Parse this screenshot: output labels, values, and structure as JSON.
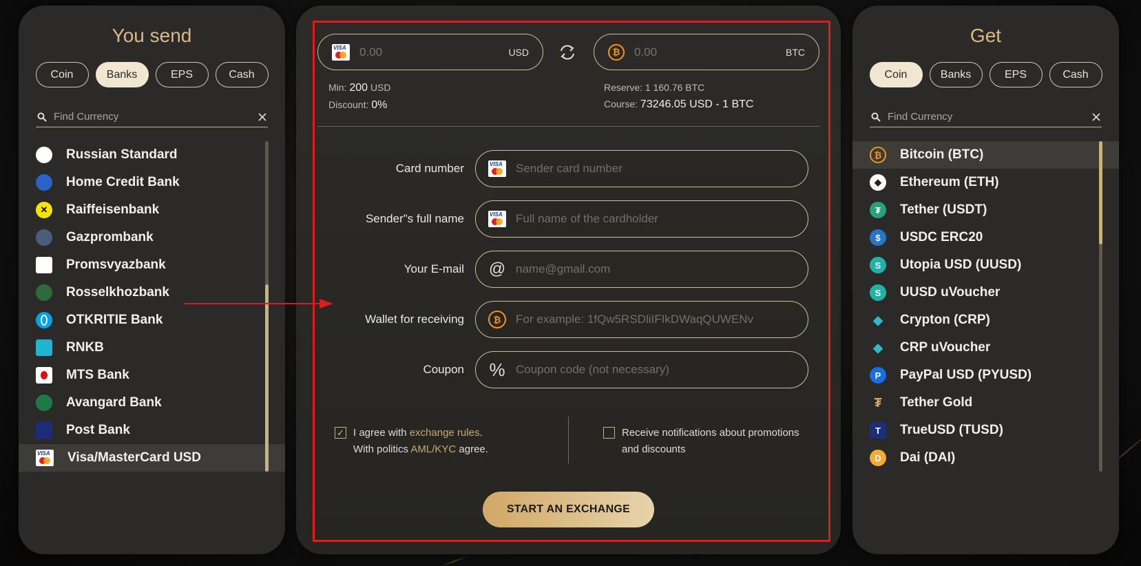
{
  "left": {
    "title": "You send",
    "filters": [
      {
        "label": "Coin",
        "active": false
      },
      {
        "label": "Banks",
        "active": true
      },
      {
        "label": "EPS",
        "active": false
      },
      {
        "label": "Cash",
        "active": false
      }
    ],
    "search_placeholder": "Find Currency",
    "items": [
      {
        "label": "Russian Standard",
        "icon": "russian-standard-icon",
        "color": "#ffffff",
        "selected": false
      },
      {
        "label": "Home Credit Bank",
        "icon": "home-credit-icon",
        "color": "#2a62c9",
        "selected": false
      },
      {
        "label": "Raiffeisenbank",
        "icon": "raiffeisen-icon",
        "color": "#f5e400",
        "selected": false
      },
      {
        "label": "Gazprombank",
        "icon": "gazprombank-icon",
        "color": "#4a5d7a",
        "selected": false
      },
      {
        "label": "Promsvyazbank",
        "icon": "promsvyazbank-icon",
        "color": "#ffffff",
        "selected": false
      },
      {
        "label": "Rosselkhozbank",
        "icon": "rosselkhozbank-icon",
        "color": "#2e6b3a",
        "selected": false
      },
      {
        "label": "OTKRITIE Bank",
        "icon": "otkritie-icon",
        "color": "#00a4e4",
        "selected": false
      },
      {
        "label": "RNKB",
        "icon": "rnkb-icon",
        "color": "#1fb5d0",
        "selected": false
      },
      {
        "label": "MTS Bank",
        "icon": "mts-bank-icon",
        "color": "#ffffff",
        "selected": false
      },
      {
        "label": "Avangard Bank",
        "icon": "avangard-icon",
        "color": "#1e7a45",
        "selected": false
      },
      {
        "label": "Post Bank",
        "icon": "post-bank-icon",
        "color": "#1c2c7a",
        "selected": false
      },
      {
        "label": "Visa/MasterCard USD",
        "icon": "visa-mastercard-icon",
        "color": "#ffffff",
        "selected": true
      }
    ]
  },
  "right": {
    "title": "Get",
    "filters": [
      {
        "label": "Coin",
        "active": true
      },
      {
        "label": "Banks",
        "active": false
      },
      {
        "label": "EPS",
        "active": false
      },
      {
        "label": "Cash",
        "active": false
      }
    ],
    "search_placeholder": "Find Currency",
    "items": [
      {
        "label": "Bitcoin (BTC)",
        "icon": "bitcoin-icon",
        "glyph": "₿",
        "color": "#f7931a",
        "selected": true
      },
      {
        "label": "Ethereum (ETH)",
        "icon": "ethereum-icon",
        "glyph": "◆",
        "color": "#ffffff",
        "selected": false
      },
      {
        "label": "Tether (USDT)",
        "icon": "tether-icon",
        "glyph": "₮",
        "color": "#26a17b",
        "selected": false
      },
      {
        "label": "USDC ERC20",
        "icon": "usdc-icon",
        "glyph": "$",
        "color": "#2775ca",
        "selected": false
      },
      {
        "label": "Utopia USD (UUSD)",
        "icon": "utopia-usd-icon",
        "glyph": "S",
        "color": "#1fb3a8",
        "selected": false
      },
      {
        "label": "UUSD uVoucher",
        "icon": "uusd-voucher-icon",
        "glyph": "S",
        "color": "#1fb3a8",
        "selected": false
      },
      {
        "label": "Crypton (CRP)",
        "icon": "crypton-icon",
        "glyph": "◆",
        "color": "#2fb9c9",
        "selected": false
      },
      {
        "label": "CRP uVoucher",
        "icon": "crp-voucher-icon",
        "glyph": "◆",
        "color": "#2fb9c9",
        "selected": false
      },
      {
        "label": "PayPal USD (PYUSD)",
        "icon": "paypal-usd-icon",
        "glyph": "P",
        "color": "#1a6fe0",
        "selected": false
      },
      {
        "label": "Tether Gold",
        "icon": "tether-gold-icon",
        "glyph": "₮",
        "color": "#d6b35a",
        "selected": false
      },
      {
        "label": "TrueUSD (TUSD)",
        "icon": "trueusd-icon",
        "glyph": "T",
        "color": "#1a2e7a",
        "selected": false
      },
      {
        "label": "Dai (DAI)",
        "icon": "dai-icon",
        "glyph": "D",
        "color": "#f5ac37",
        "selected": false
      }
    ]
  },
  "exchange": {
    "send_amount_placeholder": "0.00",
    "send_currency": "USD",
    "get_amount_placeholder": "0.00",
    "get_currency": "BTC",
    "min_label": "Min:",
    "min_value": "200",
    "min_unit": "USD",
    "discount_label": "Discount:",
    "discount_value": "0%",
    "reserve_label": "Reserve: 1 160.76 BTC",
    "course_label": "Course:",
    "course_value": "73246.05 USD - 1 BTC"
  },
  "form": {
    "fields": [
      {
        "label": "Card number",
        "placeholder": "Sender card number",
        "icon": "visa-mastercard-icon"
      },
      {
        "label": "Sender\"s full name",
        "placeholder": "Full name of the cardholder",
        "icon": "visa-mastercard-icon"
      },
      {
        "label": "Your E-mail",
        "placeholder": "name@gmail.com",
        "icon": "at-sign-icon"
      },
      {
        "label": "Wallet for receiving",
        "placeholder": "For example: 1fQw5RSDliIFIkDWaqQUWENv",
        "icon": "bitcoin-icon"
      },
      {
        "label": "Coupon",
        "placeholder": "Coupon code (not necessary)",
        "icon": "percent-icon"
      }
    ],
    "agree_prefix": "I agree with",
    "agree_link": "exchange rules",
    "agree_suffix": ".",
    "politics_prefix": "With politics",
    "politics_link": "AML/KYC",
    "politics_suffix": "agree.",
    "agree_checked": true,
    "notify_text_1": "Receive notifications about promotions",
    "notify_text_2": "and discounts",
    "notify_checked": false,
    "start_button": "START AN EXCHANGE"
  },
  "colors": {
    "accent_gold": "#d9b98a",
    "highlight_red": "#e11b1b"
  }
}
